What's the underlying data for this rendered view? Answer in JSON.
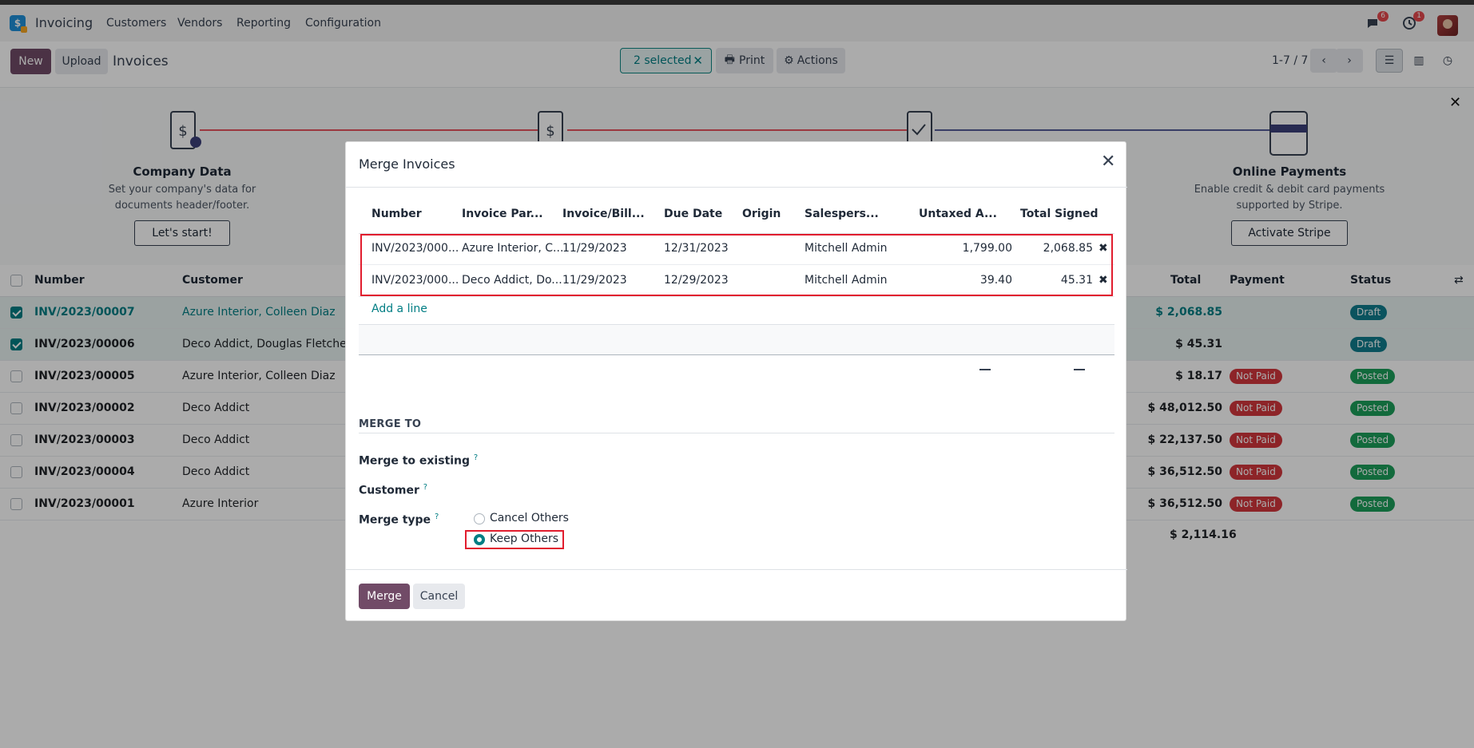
{
  "navbar": {
    "app_name": "Invoicing",
    "menu": [
      "Customers",
      "Vendors",
      "Reporting",
      "Configuration"
    ],
    "messages_count": "6",
    "activities_count": "1"
  },
  "control": {
    "new_label": "New",
    "upload_label": "Upload",
    "breadcrumb": "Invoices",
    "selected_label": "2 selected",
    "print_label": "Print",
    "actions_label": "Actions",
    "pager": "1-7 / 7"
  },
  "banner": {
    "steps": [
      {
        "title": "Company Data",
        "text": "Set your company's data for documents header/footer.",
        "button": "Let's start!"
      },
      {
        "title": "Online Payments",
        "text": "Enable credit & debit card payments supported by Stripe.",
        "button": "Activate Stripe"
      }
    ]
  },
  "list": {
    "headers": {
      "number": "Number",
      "customer": "Customer",
      "total": "Total",
      "payment": "Payment",
      "status": "Status"
    },
    "rows": [
      {
        "number": "INV/2023/00007",
        "customer": "Azure Interior, Colleen Diaz",
        "total": "$ 2,068.85",
        "payment": "",
        "status": "Draft",
        "selected": true
      },
      {
        "number": "INV/2023/00006",
        "customer": "Deco Addict, Douglas Fletcher",
        "total": "$ 45.31",
        "payment": "",
        "status": "Draft",
        "selected": true
      },
      {
        "number": "INV/2023/00005",
        "customer": "Azure Interior, Colleen Diaz",
        "total": "$ 18.17",
        "payment": "Not Paid",
        "status": "Posted",
        "selected": false
      },
      {
        "number": "INV/2023/00002",
        "customer": "Deco Addict",
        "total": "$ 48,012.50",
        "payment": "Not Paid",
        "status": "Posted",
        "selected": false
      },
      {
        "number": "INV/2023/00003",
        "customer": "Deco Addict",
        "total": "$ 22,137.50",
        "payment": "Not Paid",
        "status": "Posted",
        "selected": false
      },
      {
        "number": "INV/2023/00004",
        "customer": "Deco Addict",
        "total": "$ 36,512.50",
        "payment": "Not Paid",
        "status": "Posted",
        "selected": false
      },
      {
        "number": "INV/2023/00001",
        "customer": "Azure Interior",
        "total": "$ 36,512.50",
        "payment": "Not Paid",
        "status": "Posted",
        "selected": false
      }
    ],
    "grand_total": "$ 2,114.16"
  },
  "modal": {
    "title": "Merge Invoices",
    "columns": [
      "Number",
      "Invoice Par...",
      "Invoice/Bill...",
      "Due Date",
      "Origin",
      "Salespers...",
      "Untaxed A...",
      "Total Signed"
    ],
    "rows": [
      {
        "number": "INV/2023/000...",
        "partner": "Azure Interior, C...",
        "invoice_date": "11/29/2023",
        "due_date": "12/31/2023",
        "origin": "",
        "salesperson": "Mitchell Admin",
        "untaxed": "1,799.00",
        "total_signed": "2,068.85"
      },
      {
        "number": "INV/2023/000...",
        "partner": "Deco Addict, Do...",
        "invoice_date": "11/29/2023",
        "due_date": "12/29/2023",
        "origin": "",
        "salesperson": "Mitchell Admin",
        "untaxed": "39.40",
        "total_signed": "45.31"
      }
    ],
    "add_line": "Add a line",
    "section": "MERGE TO",
    "merge_to_existing_label": "Merge to existing",
    "customer_label": "Customer",
    "merge_type_label": "Merge type",
    "merge_type_options": [
      "Cancel Others",
      "Keep Others"
    ],
    "merge_type_selected": "Keep Others",
    "merge_button": "Merge",
    "cancel_button": "Cancel"
  },
  "colors": {
    "primary": "#714b67",
    "teal": "#017e84",
    "highlight": "#e11d2e"
  }
}
